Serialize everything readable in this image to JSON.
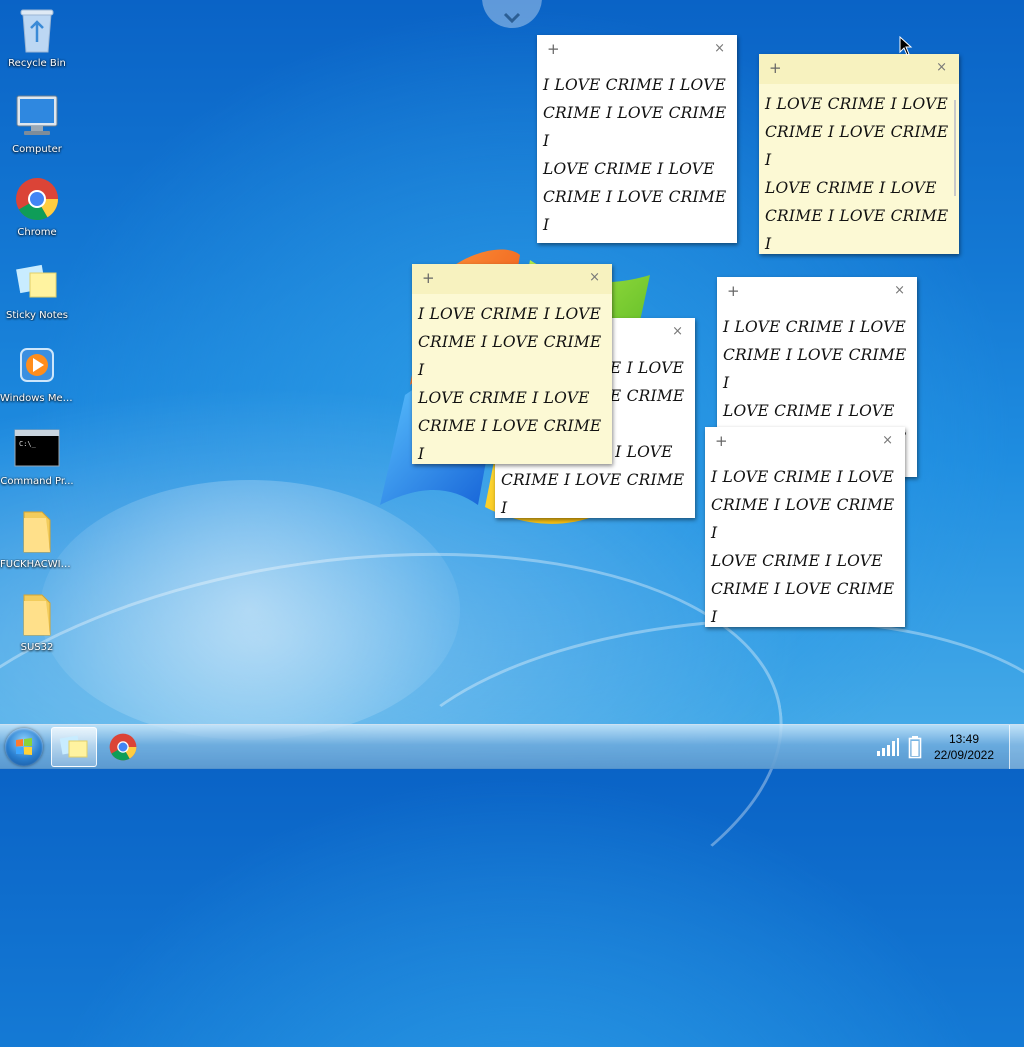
{
  "desktop": {
    "icons": [
      {
        "label": "Recycle Bin",
        "icon": "recycle-bin-icon"
      },
      {
        "label": "Computer",
        "icon": "computer-icon"
      },
      {
        "label": "Chrome",
        "icon": "chrome-icon"
      },
      {
        "label": "Sticky Notes",
        "icon": "sticky-notes-icon"
      },
      {
        "label": "Windows Med...",
        "icon": "windows-media-player-icon"
      },
      {
        "label": "Command Pr...",
        "icon": "command-prompt-icon"
      },
      {
        "label": "FUCKHACWI3.1",
        "icon": "folder-icon"
      },
      {
        "label": "SUS32",
        "icon": "folder-icon"
      }
    ]
  },
  "sticky_notes": {
    "add_glyph": "+",
    "close_glyph": "×",
    "notes": [
      {
        "lines": [
          "I LOVE CRIME I LOVE",
          "CRIME I LOVE CRIME I",
          "LOVE CRIME I LOVE",
          "CRIME I LOVE CRIME I",
          "LOVE CRIME I LOVE",
          "CRIME I LOVE CRIME I"
        ]
      },
      {
        "lines": [
          "I LOVE CRIME I LOVE",
          "CRIME I LOVE CRIME I",
          "LOVE CRIME I LOVE",
          "CRIME I LOVE CRIME I",
          "LOVE CRIME I LOVE",
          "CRIME I LOVE CRIME I"
        ]
      },
      {
        "lines": [
          "I LOVE CRIME I LOVE",
          "CRIME I LOVE CRIME I",
          "LOVE CRIME I LOVE",
          "CRIME I LOVE CRIME I",
          "LOVE CRIME I LOVE",
          "CRIME I LOVE CRIME I"
        ]
      },
      {
        "lines": [
          "I LOVE CRIME I LOVE",
          "CRIME I LOVE CRIME I",
          "LOVE CRIME I LOVE",
          "CRIME I LOVE CRIME I",
          "LOVE CRIME I LOVE",
          "CRIME I LOVE CRIME I"
        ]
      },
      {
        "lines": [
          "I LOVE CRIME I LOVE",
          "CRIME I LOVE CRIME I",
          "LOVE CRIME I LOVE",
          "CRIME I LOVE CRIME I",
          "LOVE CRIME I LOVE",
          "CRIME I LOVE CRIME I"
        ]
      },
      {
        "lines": [
          "I LOVE CRIME I LOVE",
          "CRIME I LOVE CRIME I",
          "LOVE CRIME I LOVE",
          "CRIME I LOVE CRIME I",
          "LOVE CRIME I LOVE",
          "CRIME I LOVE CRIME I"
        ]
      }
    ]
  },
  "taskbar": {
    "clock": {
      "time": "13:49",
      "date": "22/09/2022"
    },
    "pinned": [
      "sticky-notes-icon",
      "chrome-icon"
    ],
    "tray_icons": [
      "signal-icon",
      "battery-icon"
    ]
  },
  "colors": {
    "note_white": "#ffffff",
    "note_yellow": "#fcf9d4",
    "note_yellow_bar": "#f7f2bf"
  }
}
